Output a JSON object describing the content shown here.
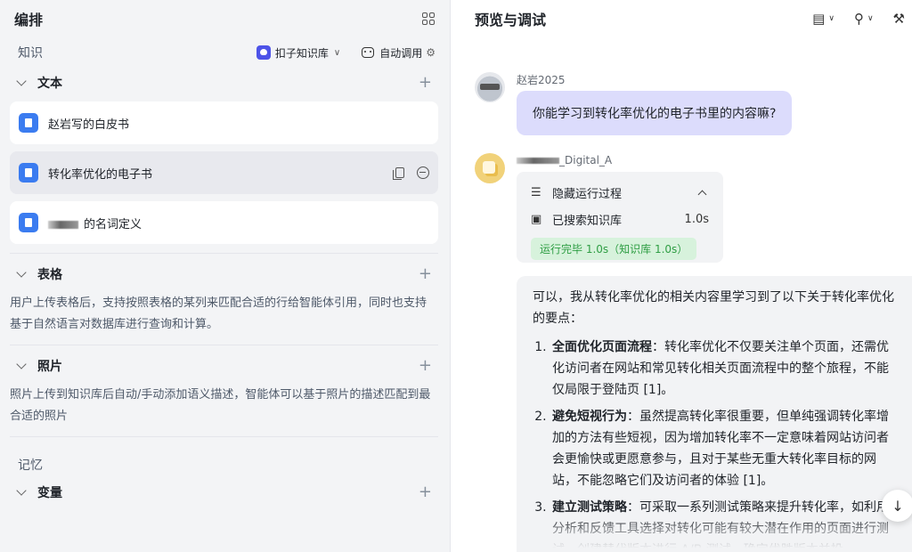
{
  "left": {
    "title": "编排",
    "knowledge": {
      "label": "知识",
      "kb_button": "扣子知识库",
      "auto_button": "自动调用"
    },
    "text_section": {
      "label": "文本",
      "docs": [
        {
          "name": "赵岩写的白皮书"
        },
        {
          "name": "转化率优化的电子书"
        },
        {
          "name": "的名词定义"
        }
      ]
    },
    "table_section": {
      "label": "表格",
      "description": "用户上传表格后，支持按照表格的某列来匹配合适的行给智能体引用，同时也支持基于自然语言对数据库进行查询和计算。"
    },
    "photo_section": {
      "label": "照片",
      "description": "照片上传到知识库后自动/手动添加语义描述，智能体可以基于照片的描述匹配到最合适的照片"
    },
    "memory_label": "记忆",
    "variable_label": "变量"
  },
  "right": {
    "title": "预览与调试",
    "user_message": {
      "sender": "赵岩2025",
      "text": "你能学习到转化率优化的电子书里的内容嘛?"
    },
    "bot": {
      "sender": "_Digital_A",
      "process": {
        "toggle_label": "隐藏运行过程",
        "search_label": "已搜索知识库",
        "search_time": "1.0s",
        "done_text": "运行完毕 1.0s（知识库 1.0s）"
      },
      "answer_intro": "可以，我从转化率优化的相关内容里学习到了以下关于转化率优化的要点：",
      "points": [
        {
          "title": "全面优化页面流程",
          "body": "：转化率优化不仅要关注单个页面，还需优化访问者在网站和常见转化相关页面流程中的整个旅程，不能仅局限于登陆页 [1]。"
        },
        {
          "title": "避免短视行为",
          "body": "：虽然提高转化率很重要，但单纯强调转化率增加的方法有些短视，因为增加转化率不一定意味着网站访问者会更愉快或更愿意参与，且对于某些无重大转化率目标的网站，不能忽略它们及访问者的体验 [1]。"
        },
        {
          "title": "建立测试策略",
          "body": "：可采取一系列测试策略来提升转化率，如利用分析和反馈工具选择对转化可能有较大潜在作用的页面进行测试，创建替代版本进行 A/B 测试，确定优胜版本并投"
        }
      ]
    }
  },
  "icons": {
    "layout": "grid-icon",
    "scroll": "arrow-down-icon"
  }
}
